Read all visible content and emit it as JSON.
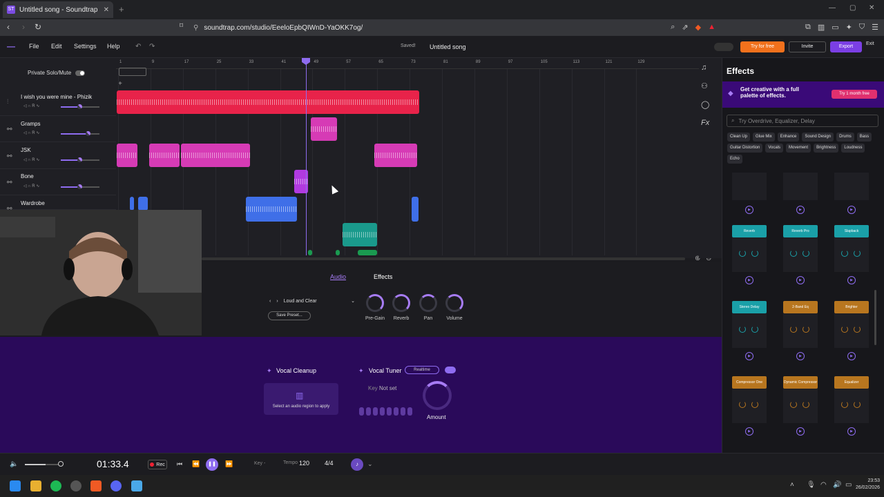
{
  "browser": {
    "tab_title": "Untitled song - Soundtrap",
    "url": "soundtrap.com/studio/EeeloEpbQIWnD-YaOKK7og/"
  },
  "menu": [
    "File",
    "Edit",
    "Settings",
    "Help"
  ],
  "header": {
    "saved": "Saved!",
    "song_title": "Untitled song",
    "try_free": "Try for free",
    "invite": "Invite",
    "export": "Export",
    "exit": "Exit"
  },
  "private_solo_mute": "Private Solo/Mute",
  "ruler": [
    "1",
    "9",
    "17",
    "25",
    "33",
    "41",
    "49",
    "57",
    "65",
    "73",
    "81",
    "89",
    "97",
    "105",
    "113",
    "121",
    "129"
  ],
  "tracks": [
    {
      "name": "I wish you were mine - Phizik",
      "color": "#e8234a",
      "volume": 0.5
    },
    {
      "name": "Gramps",
      "color": "#d63bb5",
      "volume": 0.7
    },
    {
      "name": "JSK",
      "color": "#d63bb5",
      "volume": 0.5
    },
    {
      "name": "Bone",
      "color": "#b13ae0",
      "volume": 0.5
    },
    {
      "name": "Wardrobe",
      "color": "#3f6fe8",
      "volume": 0.5
    }
  ],
  "effects_panel": {
    "tab_audio": "Audio",
    "tab_effects": "Effects",
    "preset": "Loud and Clear",
    "save_preset": "Save Preset...",
    "knobs": [
      "Pre-Gain",
      "Reverb",
      "Pan",
      "Volume"
    ]
  },
  "vocal": {
    "cleanup_title": "Vocal Cleanup",
    "cleanup_hint": "Select an audio region to apply",
    "tuner_title": "Vocal Tuner",
    "realtime": "Realtime",
    "key_label": "Key",
    "key_value": "Not set",
    "amount": "Amount"
  },
  "sidebar": {
    "title": "Effects",
    "promo": "Get creative with a full palette of effects.",
    "promo_btn": "Try 1 month free",
    "search_placeholder": "Try Overdrive, Equalizer, Delay",
    "chips": [
      "Clean Up",
      "Glue Mix",
      "Enhance",
      "Sound Design",
      "Drums",
      "Bass",
      "Guitar Distortion",
      "Vocals",
      "Movement",
      "Brightness",
      "Loudness",
      "Echo"
    ],
    "cards": [
      {
        "name": "Reverb",
        "color": "#1aa0a8"
      },
      {
        "name": "Reverb Pro",
        "color": "#1aa0a8"
      },
      {
        "name": "Slapback",
        "color": "#1aa0a8"
      },
      {
        "name": "Stereo Delay",
        "color": "#1aa0a8"
      },
      {
        "name": "2-Band Eq",
        "color": "#b8761f"
      },
      {
        "name": "Brighter",
        "color": "#b8761f"
      },
      {
        "name": "Compressor One",
        "color": "#b8761f"
      },
      {
        "name": "Dynamic Compressor",
        "color": "#b8761f"
      },
      {
        "name": "Equalizer",
        "color": "#b8761f"
      }
    ]
  },
  "transport": {
    "time": "01:33.4",
    "rec": "Rec",
    "key": "Key -",
    "tempo_label": "Tempo",
    "tempo": "120",
    "time_sig": "4/4"
  },
  "taskbar": {
    "time": "23:53",
    "date": "26/02/2026"
  }
}
